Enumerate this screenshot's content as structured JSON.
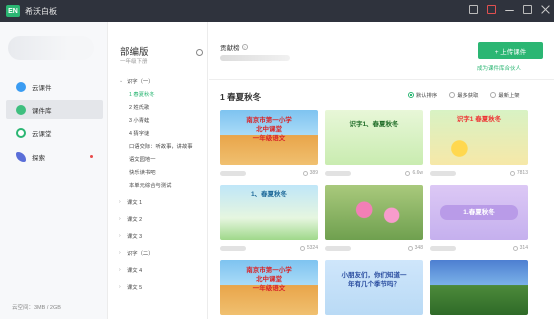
{
  "app": {
    "title": "希沃白板",
    "logo": "EN"
  },
  "colors": {
    "accent": "#2bb673",
    "titlebar": "#2f333d"
  },
  "nav": {
    "items": [
      {
        "label": "云课件",
        "icon": "cloud-icon",
        "color": "#3a9cf2"
      },
      {
        "label": "课件库",
        "icon": "gem-icon",
        "color": "#3fbf7f"
      },
      {
        "label": "云课堂",
        "icon": "classroom-icon",
        "color": "#2bb673"
      },
      {
        "label": "探索",
        "icon": "rocket-icon",
        "color": "#5a6ed8"
      }
    ],
    "storage": "云空间：3MB / 2GB"
  },
  "catalog": {
    "title": "部编版",
    "subtitle": "一年级下册",
    "items": [
      {
        "label": "识字（一）",
        "level": "root",
        "arrow": "⌄"
      },
      {
        "label": "1 春夏秋冬",
        "level": "child",
        "active": true
      },
      {
        "label": "2 姓氏歌",
        "level": "child"
      },
      {
        "label": "3 小青蛙",
        "level": "child"
      },
      {
        "label": "4 猜字谜",
        "level": "child"
      },
      {
        "label": "口语交际：听故事，讲故事",
        "level": "child"
      },
      {
        "label": "语文园地一",
        "level": "child"
      },
      {
        "label": "快乐读书吧",
        "level": "child"
      },
      {
        "label": "本单元综合与测试",
        "level": "child"
      },
      {
        "label": "课文 1",
        "level": "root",
        "arrow": "›",
        "gap": true
      },
      {
        "label": "课文 2",
        "level": "root",
        "arrow": "›",
        "gap": true
      },
      {
        "label": "课文 3",
        "level": "root",
        "arrow": "›",
        "gap": true
      },
      {
        "label": "识字（二）",
        "level": "root",
        "arrow": "›",
        "gap": true
      },
      {
        "label": "课文 4",
        "level": "root",
        "arrow": "›",
        "gap": true
      },
      {
        "label": "课文 5",
        "level": "root",
        "arrow": "›",
        "gap": true
      }
    ]
  },
  "main": {
    "contributors_label": "贡献榜",
    "upload_label": "+ 上传课件",
    "author_link": "成为课件库合伙人",
    "section_title": "1 春夏秋冬",
    "sort_options": [
      {
        "label": "默认排序",
        "selected": true
      },
      {
        "label": "最多获取",
        "selected": false
      },
      {
        "label": "最新上架",
        "selected": false
      }
    ],
    "cards": [
      {
        "caption": "南京市第一小学\n北中课堂\n一年级语文",
        "count": "389",
        "bg": "school"
      },
      {
        "caption": "识字1、春夏秋冬",
        "count": "6.6w",
        "bg": "green"
      },
      {
        "caption": "识字1 春夏秋冬",
        "count": "7813",
        "bg": "spring"
      },
      {
        "caption": "1、春夏秋冬",
        "count": "5324",
        "bg": "panel"
      },
      {
        "caption": "",
        "count": "348",
        "bg": "flowers"
      },
      {
        "caption": "1.春夏秋冬",
        "count": "314",
        "bg": "lavender"
      },
      {
        "caption": "南京市第一小学\n北中课堂\n一年级语文",
        "count": "",
        "bg": "school2"
      },
      {
        "caption": "小朋友们，你们知道一\n年有几个季节吗？",
        "count": "",
        "bg": "question"
      },
      {
        "caption": "",
        "count": "",
        "bg": "trees"
      }
    ]
  }
}
